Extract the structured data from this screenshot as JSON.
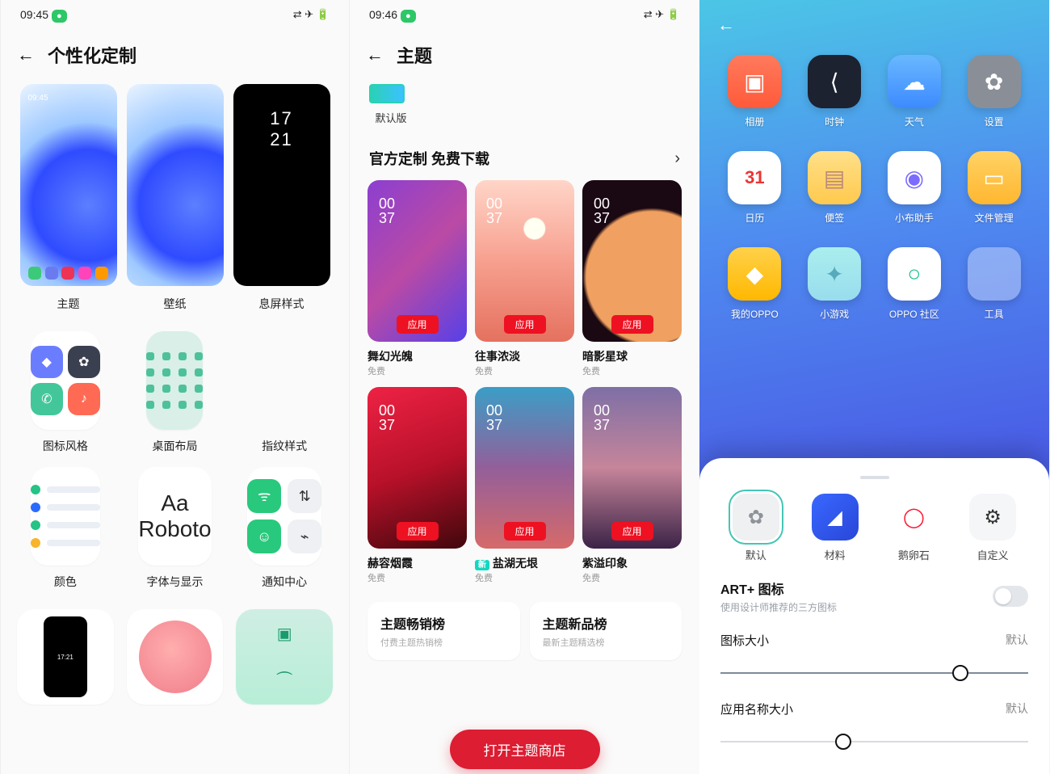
{
  "panel1": {
    "time": "09:45",
    "title": "个性化定制",
    "top": [
      {
        "label": "主题",
        "clock": "09:45"
      },
      {
        "label": "壁纸"
      },
      {
        "label": "息屏样式",
        "clock": "17\n21"
      }
    ],
    "grid": [
      {
        "label": "图标风格"
      },
      {
        "label": "桌面布局"
      },
      {
        "label": "指纹样式"
      },
      {
        "label": "颜色"
      },
      {
        "label": "字体与显示",
        "Aa": "Aa",
        "font": "Roboto"
      },
      {
        "label": "通知中心"
      }
    ]
  },
  "panel2": {
    "time": "09:46",
    "title": "主题",
    "tab": "默认版",
    "section": "官方定制 免费下载",
    "apply": "应用",
    "themes": [
      {
        "name": "舞幻光魄",
        "sub": "免费"
      },
      {
        "name": "往事浓淡",
        "sub": "免费"
      },
      {
        "name": "暗影星球",
        "sub": "免费"
      },
      {
        "name": "赫容烟霞",
        "sub": "免费"
      },
      {
        "name": "盐湖无垠",
        "sub": "免费",
        "new": "新"
      },
      {
        "name": "紫溢印象",
        "sub": "免费"
      }
    ],
    "theme_time": "00\n37",
    "ranks": [
      {
        "title": "主题畅销榜",
        "sub": "付费主题热销榜"
      },
      {
        "title": "主题新品榜",
        "sub": "最新主题精选榜"
      }
    ],
    "store_btn": "打开主题商店"
  },
  "panel3": {
    "apps": [
      {
        "label": "相册",
        "icon": "▣"
      },
      {
        "label": "时钟",
        "icon": "⟨"
      },
      {
        "label": "天气",
        "icon": "☁"
      },
      {
        "label": "设置",
        "icon": "✿"
      },
      {
        "label": "日历",
        "icon": "31"
      },
      {
        "label": "便签",
        "icon": "▤"
      },
      {
        "label": "小布助手",
        "icon": "◉"
      },
      {
        "label": "文件管理",
        "icon": "▭"
      },
      {
        "label": "我的OPPO",
        "icon": "◆"
      },
      {
        "label": "小游戏",
        "icon": "✦"
      },
      {
        "label": "OPPO 社区",
        "icon": "○"
      },
      {
        "label": "工具",
        "icon": ""
      }
    ],
    "styles": [
      {
        "label": "默认"
      },
      {
        "label": "材料"
      },
      {
        "label": "鹅卵石"
      },
      {
        "label": "自定义"
      }
    ],
    "art_title": "ART+ 图标",
    "art_sub": "使用设计师推荐的三方图标",
    "sliders": [
      {
        "title": "图标大小",
        "value": "默认",
        "pos": 78
      },
      {
        "title": "应用名称大小",
        "value": "默认",
        "pos": 40
      }
    ]
  }
}
